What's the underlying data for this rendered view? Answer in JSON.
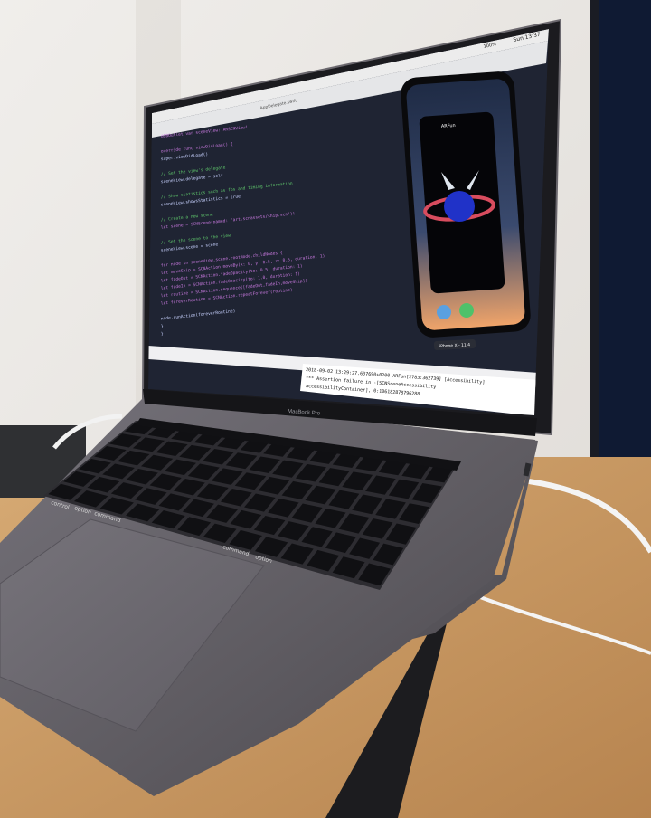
{
  "photo": {
    "laptop_brand": "MacBook Pro",
    "menu_bar_clock": "Sun 13:37",
    "menu_bar_battery": "100%",
    "window_title": "AppDelegate.swift",
    "code_lines": [
      "@IBOutlet var sceneView: ARSCNView!",
      "",
      "override func viewDidLoad() {",
      "    super.viewDidLoad()",
      "",
      "    // Set the view's delegate",
      "    sceneView.delegate = self",
      "",
      "    // Show statistics such as fps and timing information",
      "    sceneView.showsStatistics = true",
      "",
      "    // Create a new scene",
      "    let scene = SCNScene(named: \"art.scnassets/ship.scn\")!",
      "",
      "    // Set the scene to the view",
      "    sceneView.scene = scene",
      "",
      "    for node in sceneView.scene.rootNode.childNodes {",
      "        let moveShip = SCNAction.moveBy(x: 0, y: 0.5, z: 0.5, duration: 1)",
      "        let fadeOut = SCNAction.fadeOpacity(to: 0.5, duration: 1)",
      "        let fadeIn = SCNAction.fadeOpacity(to: 1.0, duration: 1)",
      "        let routine = SCNAction.sequence([fadeOut,fadeIn,moveShip])",
      "        let foreverRoutine = SCNAction.repeatForever(routine)",
      "",
      "        node.runAction(foreverRoutine)",
      "    }",
      "}"
    ],
    "console_lines": [
      "2018-09-02 13:29:27.607690+0200 ARFun[2783:362739] [Accessibility]",
      "*** Assertion failure in -[SCNSceneAccessibility",
      "accessibilityContainer], 0:106182878796288."
    ],
    "simulator_app_name": "ARFun",
    "simulator_device_label": "iPhone X - 11.4",
    "keyboard_labels": {
      "control": "control",
      "option": "option",
      "command": "command",
      "command_right": "command",
      "option_right": "option"
    },
    "colors": {
      "wall": "#e9e6e2",
      "desk": "#c99a63",
      "laptop_body": "#5d5a5f",
      "editor_bg": "#1f2433",
      "keyword": "#c678dd",
      "string": "#e5c07b",
      "comment": "#5ec46b"
    }
  }
}
